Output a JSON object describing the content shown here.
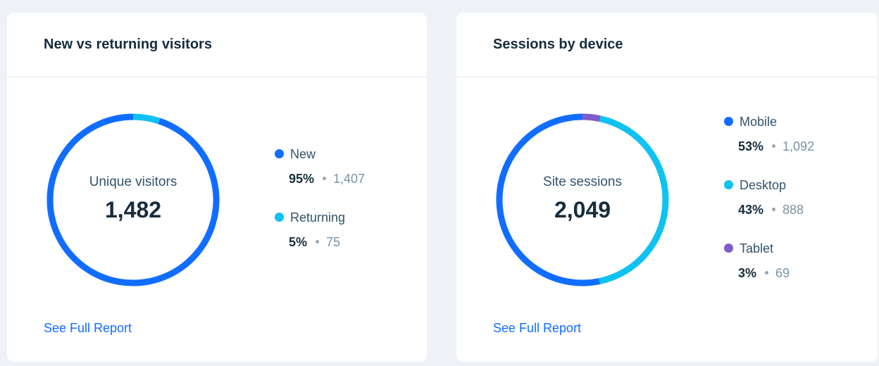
{
  "cards": [
    {
      "title": "New vs returning visitors",
      "center_label": "Unique visitors",
      "center_value": "1,482",
      "legend": [
        {
          "label": "New",
          "percent": "95%",
          "count": "1,407",
          "color": "#116dff"
        },
        {
          "label": "Returning",
          "percent": "5%",
          "count": "75",
          "color": "#0fc2f1"
        }
      ],
      "link_label": "See Full Report"
    },
    {
      "title": "Sessions by device",
      "center_label": "Site sessions",
      "center_value": "2,049",
      "legend": [
        {
          "label": "Mobile",
          "percent": "53%",
          "count": "1,092",
          "color": "#116dff"
        },
        {
          "label": "Desktop",
          "percent": "43%",
          "count": "888",
          "color": "#0fc2f1"
        },
        {
          "label": "Tablet",
          "percent": "3%",
          "count": "69",
          "color": "#7e5cc9"
        }
      ],
      "link_label": "See Full Report"
    }
  ],
  "chart_data": [
    {
      "type": "pie",
      "categories": [
        "New",
        "Returning"
      ],
      "values": [
        1407,
        75
      ],
      "colors": [
        "#116dff",
        "#0fc2f1"
      ]
    },
    {
      "type": "pie",
      "categories": [
        "Mobile",
        "Desktop",
        "Tablet"
      ],
      "values": [
        1092,
        888,
        69
      ],
      "colors": [
        "#116dff",
        "#0fc2f1",
        "#7e5cc9"
      ]
    }
  ]
}
